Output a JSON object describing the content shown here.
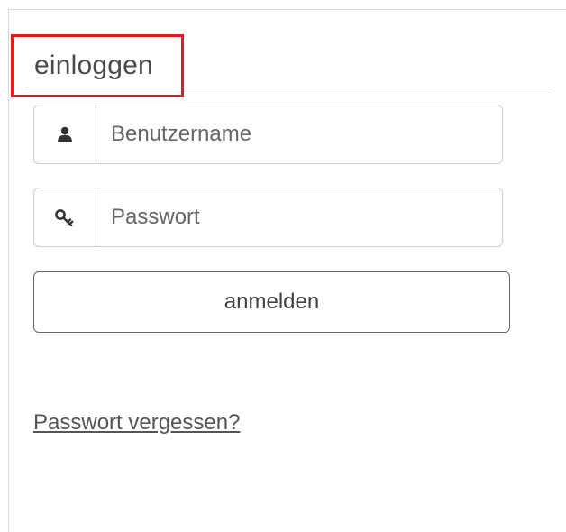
{
  "login": {
    "heading": "einloggen",
    "username": {
      "placeholder": "Benutzername",
      "value": "",
      "icon": "user-icon"
    },
    "password": {
      "placeholder": "Passwort",
      "value": "",
      "icon": "key-icon"
    },
    "submit_label": "anmelden",
    "forgot_link": "Passwort vergessen?"
  },
  "colors": {
    "highlight": "#e21b1b",
    "text": "#4a4a4a",
    "border": "#cfcfcf"
  }
}
